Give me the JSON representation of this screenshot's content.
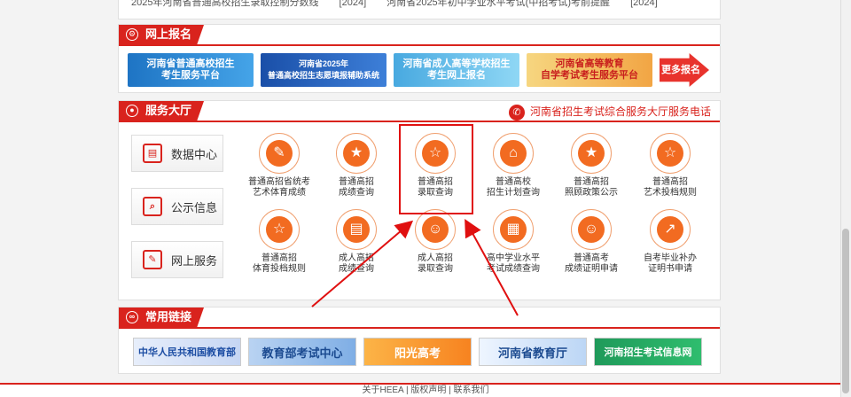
{
  "top": {
    "left_text": "2025年河南省普通高校招生录取控制分数线",
    "left_date": "[2024]",
    "right_text": "河南省2025年初中学业水平考试(中招考试)考前提醒",
    "right_date": "[2024]"
  },
  "online_reg": {
    "title": "网上报名",
    "banners": [
      {
        "line1": "河南省普通高校招生",
        "line2": "考生服务平台"
      },
      {
        "line1": "河南省2025年",
        "line2": "普通高校招生志愿填报辅助系统"
      },
      {
        "line1": "河南省成人高等学校招生",
        "line2": "考生网上报名"
      },
      {
        "line1": "河南省高等教育",
        "line2": "自学考试考生服务平台"
      }
    ],
    "more": "更多报名"
  },
  "service": {
    "title": "服务大厅",
    "phone": "河南省招生考试综合服务大厅服务电话",
    "side": [
      "数据中心",
      "公示信息",
      "网上服务"
    ],
    "items": [
      {
        "l1": "普通高招省统考",
        "l2": "艺术体育成绩",
        "icon": "✎"
      },
      {
        "l1": "普通高招",
        "l2": "成绩查询",
        "icon": "★"
      },
      {
        "l1": "普通高招",
        "l2": "录取查询",
        "icon": "☆"
      },
      {
        "l1": "普通高校",
        "l2": "招生计划查询",
        "icon": "⌂"
      },
      {
        "l1": "普通高招",
        "l2": "照顾政策公示",
        "icon": "★"
      },
      {
        "l1": "普通高招",
        "l2": "艺术投档规则",
        "icon": "☆"
      },
      {
        "l1": "普通高招",
        "l2": "体育投档规则",
        "icon": "☆"
      },
      {
        "l1": "成人高招",
        "l2": "成绩查询",
        "icon": "▤"
      },
      {
        "l1": "成人高招",
        "l2": "录取查询",
        "icon": "☺"
      },
      {
        "l1": "高中学业水平",
        "l2": "考试成绩查询",
        "icon": "▦"
      },
      {
        "l1": "普通高考",
        "l2": "成绩证明申请",
        "icon": "☺"
      },
      {
        "l1": "自考毕业补办",
        "l2": "证明书申请",
        "icon": "↗"
      }
    ]
  },
  "links": {
    "title": "常用链接",
    "items": [
      "中华人民共和国教育部",
      "教育部考试中心",
      "阳光高考",
      "河南省教育厅",
      "河南招生考试信息网"
    ]
  },
  "footer": "关于HEEA | 版权声明 | 联系我们",
  "colors": {
    "brand_red": "#d9231d",
    "icon_orange": "#f26b21"
  }
}
